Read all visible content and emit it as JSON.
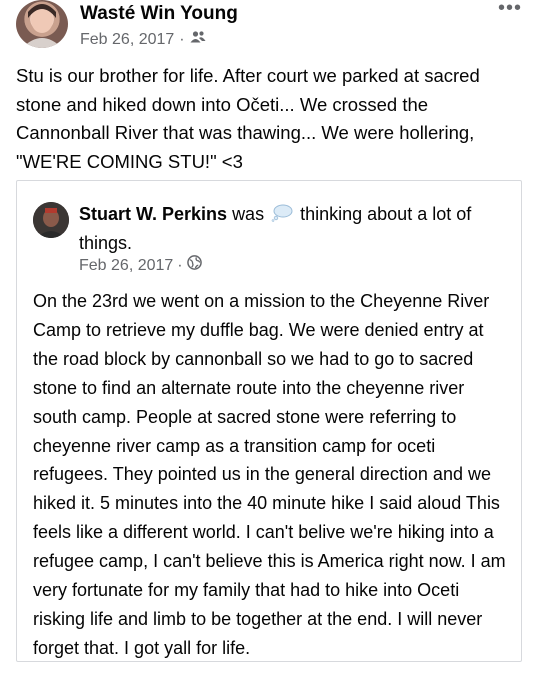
{
  "post": {
    "author": "Wasté Win Young",
    "date": "Feb 26, 2017",
    "privacy_icon": "friends-icon",
    "more_icon": "more-icon",
    "more_label": "•••",
    "text": "Stu is our brother for life. After court we parked at sacred stone and hiked down into Očeti... We crossed the Cannonball River that was thawing... We were hollering, \"WE'RE COMING STU!\" <3"
  },
  "shared_post": {
    "author": "Stuart W. Perkins",
    "was": "was",
    "activity": "thinking about a lot of things.",
    "activity_icon": "thought-bubble-icon",
    "date": "Feb 26, 2017",
    "privacy_icon": "globe-icon",
    "text": "On the 23rd we went on a mission to the Cheyenne River Camp to retrieve my duffle bag. We were denied entry at the road block by cannonball so we had to go to sacred stone to find an alternate route into the cheyenne river south camp. People at sacred stone were referring to cheyenne river camp as a transition camp for oceti refugees. They pointed us in the general direction and we hiked it. 5 minutes into the 40 minute hike I said aloud This feels like a different world. I can't belive we're hiking into a refugee camp, I can't believe this is America right now. I am very fortunate for my family that had to hike into Oceti risking life and limb to be together at the end. I will never forget that. I got yall for life."
  },
  "separator": "·"
}
